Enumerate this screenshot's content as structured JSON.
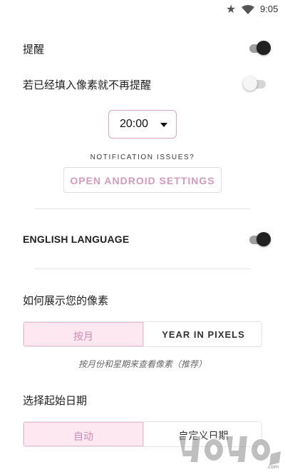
{
  "status_bar": {
    "time": "9:05",
    "icons": [
      "star-icon",
      "wifi-icon"
    ]
  },
  "reminder": {
    "label": "提醒",
    "enabled": true
  },
  "skip_if_filled": {
    "label": "若已经填入像素就不再提醒",
    "enabled": false
  },
  "reminder_time": {
    "value": "20:00"
  },
  "notification_issues": {
    "text": "NOTIFICATION ISSUES?",
    "button_label": "OPEN ANDROID SETTINGS"
  },
  "english_language": {
    "label": "ENGLISH LANGUAGE",
    "enabled": true
  },
  "display_mode": {
    "label": "如何展示您的像素",
    "options": [
      "按月",
      "YEAR IN PIXELS"
    ],
    "selected": "按月",
    "hint": "按月份和星期来查看像素（推荐）"
  },
  "start_date": {
    "label": "选择起始日期",
    "options": [
      "自动",
      "自定义日期"
    ],
    "selected": "自动"
  },
  "colors": {
    "accent": "#d18cb3",
    "accent_bg": "#fde7f1",
    "toggle_on": "#212121"
  }
}
